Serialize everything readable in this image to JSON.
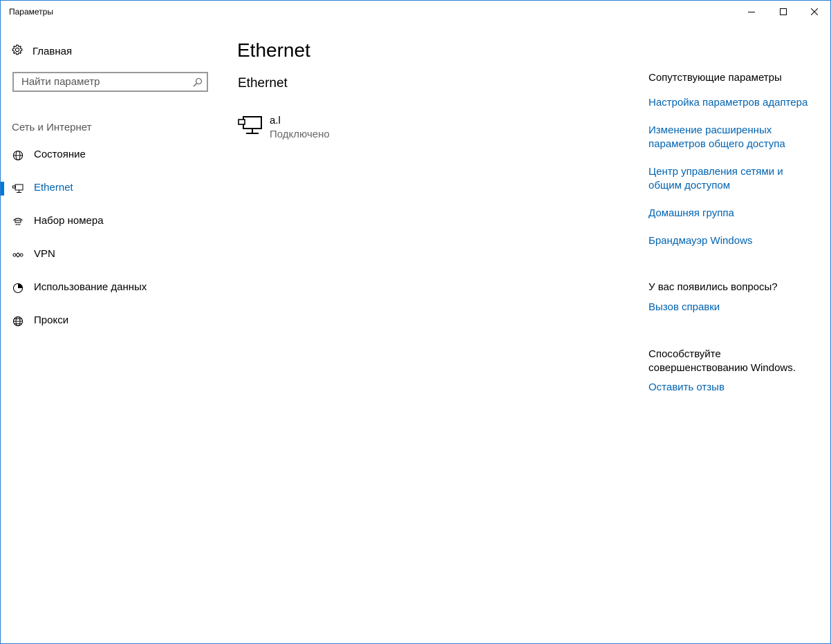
{
  "window": {
    "title": "Параметры"
  },
  "nav": {
    "home_label": "Главная",
    "search_placeholder": "Найти параметр",
    "section_label": "Сеть и Интернет",
    "items": [
      {
        "label": "Состояние",
        "icon": "globe-status-icon"
      },
      {
        "label": "Ethernet",
        "icon": "ethernet-icon",
        "active": true
      },
      {
        "label": "Набор номера",
        "icon": "dialup-icon"
      },
      {
        "label": "VPN",
        "icon": "vpn-icon"
      },
      {
        "label": "Использование данных",
        "icon": "data-usage-icon"
      },
      {
        "label": "Прокси",
        "icon": "globe-icon"
      }
    ]
  },
  "main": {
    "page_title": "Ethernet",
    "section_title": "Ethernet",
    "connection": {
      "name": "a.l",
      "status": "Подключено",
      "icon": "network-computer-icon"
    }
  },
  "related": {
    "heading": "Сопутствующие параметры",
    "links": [
      "Настройка параметров адаптера",
      "Изменение расширенных параметров общего доступа",
      "Центр управления сетями и общим доступом",
      "Домашняя группа",
      "Брандмауэр Windows"
    ]
  },
  "help": {
    "heading": "У вас появились вопросы?",
    "link": "Вызов справки"
  },
  "feedback": {
    "text": "Способствуйте совершенствованию Windows.",
    "link": "Оставить отзыв"
  },
  "colors": {
    "accent": "#0078d7",
    "link": "#0063b1",
    "window_border": "#2b7fd2"
  }
}
